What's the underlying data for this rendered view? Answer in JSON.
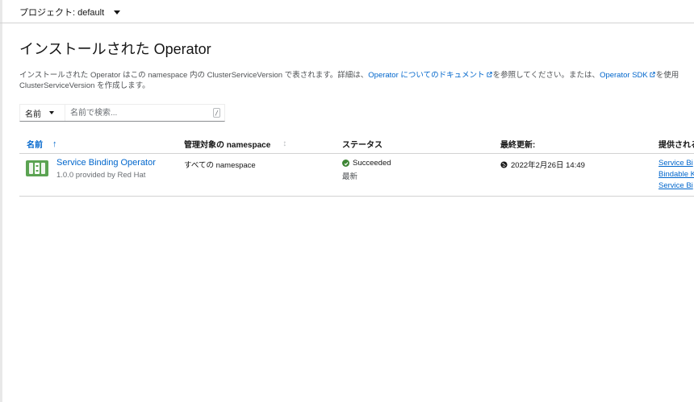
{
  "project": {
    "label": "プロジェクト: default"
  },
  "page": {
    "title": "インストールされた Operator"
  },
  "description": {
    "text1": "インストールされた Operator はこの namespace 内の ClusterServiceVersion で表されます。詳細は、",
    "link1": "Operator についてのドキュメント",
    "text2": "を参照してください。または、",
    "link2": "Operator SDK",
    "text3": "を使用",
    "line2": "ClusterServiceVersion を作成します。"
  },
  "filter": {
    "type_label": "名前",
    "placeholder": "名前で検索...",
    "shortcut": "/"
  },
  "table": {
    "columns": {
      "name": "名前",
      "namespace": "管理対象の namespace",
      "status": "ステータス",
      "last_updated": "最終更新:",
      "provided_apis": "提供される"
    },
    "rows": [
      {
        "name": "Service Binding Operator",
        "provider": "1.0.0 provided by Red Hat",
        "namespace": "すべての namespace",
        "status": "Succeeded",
        "status_sub": "最新",
        "last_updated": "2022年2月26日 14:49",
        "apis": [
          "Service Bi",
          "Bindable K",
          "Service Bi"
        ]
      }
    ]
  },
  "colors": {
    "link": "#0066cc",
    "success": "#3e8635",
    "logo": "#5ba352"
  },
  "icons": {
    "dropdown": "caret-down-icon",
    "external": "external-link-icon",
    "sort": "sort-ascending-icon",
    "status": "check-circle-icon",
    "time": "globe-icon",
    "logo": "operator-logo-icon"
  }
}
